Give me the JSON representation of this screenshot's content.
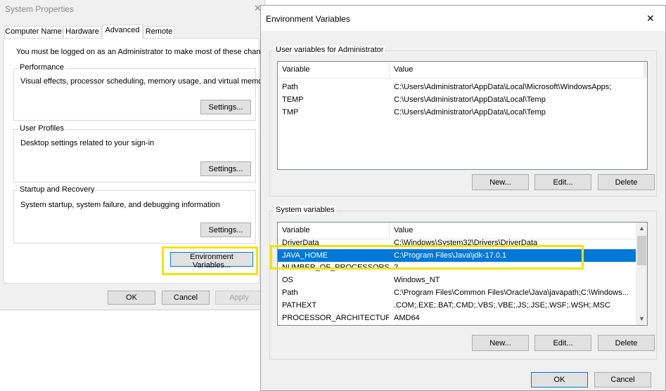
{
  "sysprops": {
    "title": "System Properties",
    "tabs": [
      "Computer Name",
      "Hardware",
      "Advanced",
      "Remote"
    ],
    "admin_note": "You must be logged on as an Administrator to make most of these changes.",
    "performance": {
      "title": "Performance",
      "desc": "Visual effects, processor scheduling, memory usage, and virtual memory",
      "button": "Settings..."
    },
    "profiles": {
      "title": "User Profiles",
      "desc": "Desktop settings related to your sign-in",
      "button": "Settings..."
    },
    "startup": {
      "title": "Startup and Recovery",
      "desc": "System startup, system failure, and debugging information",
      "button": "Settings..."
    },
    "env_button": "Environment Variables...",
    "ok": "OK",
    "cancel": "Cancel",
    "apply": "Apply"
  },
  "envvars": {
    "title": "Environment Variables",
    "close_glyph": "✕",
    "user_group_title": "User variables for Administrator",
    "system_group_title": "System variables",
    "col_variable": "Variable",
    "col_value": "Value",
    "user_rows": [
      {
        "variable": "Path",
        "value": "C:\\Users\\Administrator\\AppData\\Local\\Microsoft\\WindowsApps;"
      },
      {
        "variable": "TEMP",
        "value": "C:\\Users\\Administrator\\AppData\\Local\\Temp"
      },
      {
        "variable": "TMP",
        "value": "C:\\Users\\Administrator\\AppData\\Local\\Temp"
      }
    ],
    "system_rows": [
      {
        "variable": "DriverData",
        "value": "C:\\Windows\\System32\\Drivers\\DriverData"
      },
      {
        "variable": "JAVA_HOME",
        "value": "C:\\Program Files\\Java\\jdk-17.0.1"
      },
      {
        "variable": "NUMBER_OF_PROCESSORS",
        "value": "2"
      },
      {
        "variable": "OS",
        "value": "Windows_NT"
      },
      {
        "variable": "Path",
        "value": "C:\\Program Files\\Common Files\\Oracle\\Java\\javapath;C:\\Windows..."
      },
      {
        "variable": "PATHEXT",
        "value": ".COM;.EXE;.BAT;.CMD;.VBS;.VBE;.JS;.JSE;.WSF;.WSH;.MSC"
      },
      {
        "variable": "PROCESSOR_ARCHITECTURE",
        "value": "AMD64"
      }
    ],
    "selected_system_row": 1,
    "user_buttons": {
      "new": "New...",
      "edit": "Edit...",
      "delete": "Delete"
    },
    "system_buttons": {
      "new": "New...",
      "edit": "Edit...",
      "delete": "Delete"
    },
    "ok": "OK",
    "cancel": "Cancel"
  },
  "colors": {
    "selection": "#0078d7",
    "highlight_box": "#f2e400"
  }
}
